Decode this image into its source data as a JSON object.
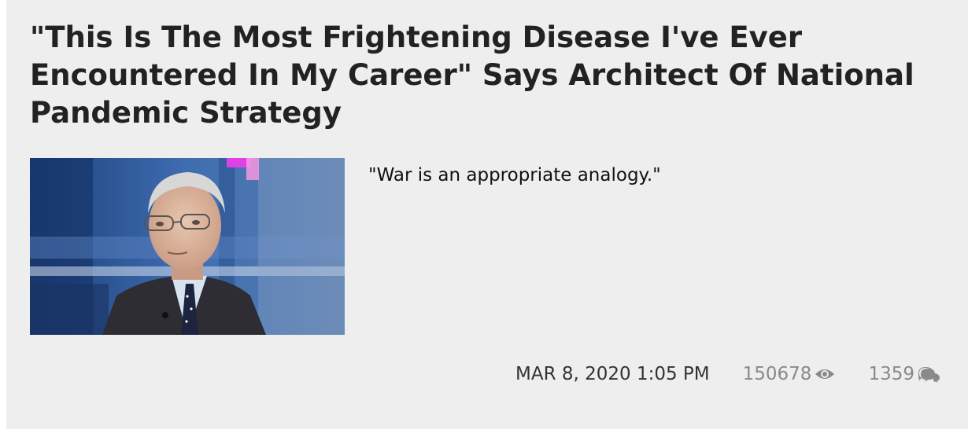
{
  "article": {
    "title": "\"This Is The Most Frightening Disease I've Ever Encountered In My Career\" Says Architect Of National Pandemic Strategy",
    "teaser": "\"War is an appropriate analogy.\"",
    "date": "MAR 8, 2020 1:05 PM",
    "views": "150678",
    "comments": "1359",
    "icons": {
      "views": "eye-icon",
      "comments": "comments-icon"
    },
    "colors": {
      "card_bg": "#eeeeee",
      "title": "#222222",
      "meta_muted": "#8a8a8a"
    }
  }
}
